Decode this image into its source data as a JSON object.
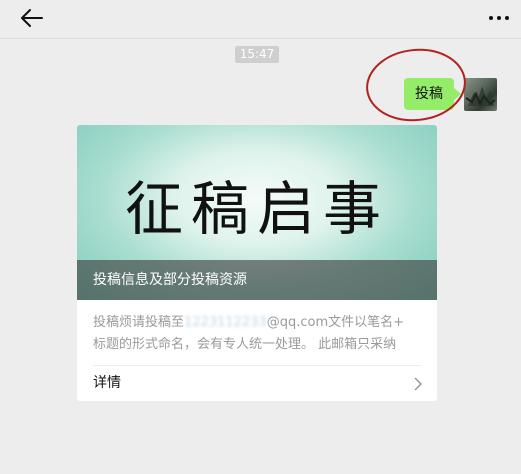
{
  "header": {
    "back_icon": "back-arrow-icon",
    "more_icon": "more-dots-icon"
  },
  "chat": {
    "timestamp": "15:47",
    "sent_message": "投稿",
    "bubble_color": "#95ec69",
    "avatar_icon": "user-avatar"
  },
  "card": {
    "banner_text": "征稿启事",
    "caption": "投稿信息及部分投稿资源",
    "description_line1_prefix": "投稿烦请投稿至",
    "description_line1_redacted": "1223112233",
    "description_line1_suffix": "@qq.com文件以笔名+",
    "description_line2": "标题的形式命名，会有专人统一处理。 此邮箱只采纳",
    "details_label": "详情",
    "details_icon": "chevron-right-icon"
  },
  "annotation": {
    "circle_color": "#b3211e"
  }
}
